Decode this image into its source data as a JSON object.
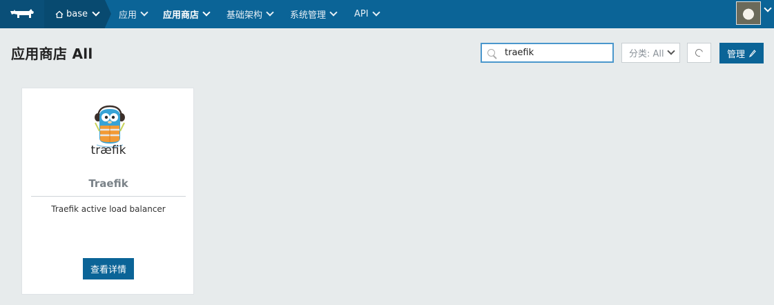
{
  "nav": {
    "environment": "base",
    "items": [
      {
        "label": "应用",
        "active": false
      },
      {
        "label": "应用商店",
        "active": true
      },
      {
        "label": "基础架构",
        "active": false
      },
      {
        "label": "系统管理",
        "active": false
      },
      {
        "label": "API",
        "active": false
      }
    ]
  },
  "page": {
    "title": "应用商店 All"
  },
  "search": {
    "value": "traefik"
  },
  "category": {
    "selected": "分类: All"
  },
  "manage_label": "管理",
  "catalog": [
    {
      "logo_text": "træfik",
      "name": "Traefik",
      "description": "Traefik active load balancer",
      "button_label": "查看详情"
    }
  ],
  "colors": {
    "nav_bg": "#0b6497",
    "accent": "#0b6497",
    "page_bg": "#e7ebec"
  }
}
